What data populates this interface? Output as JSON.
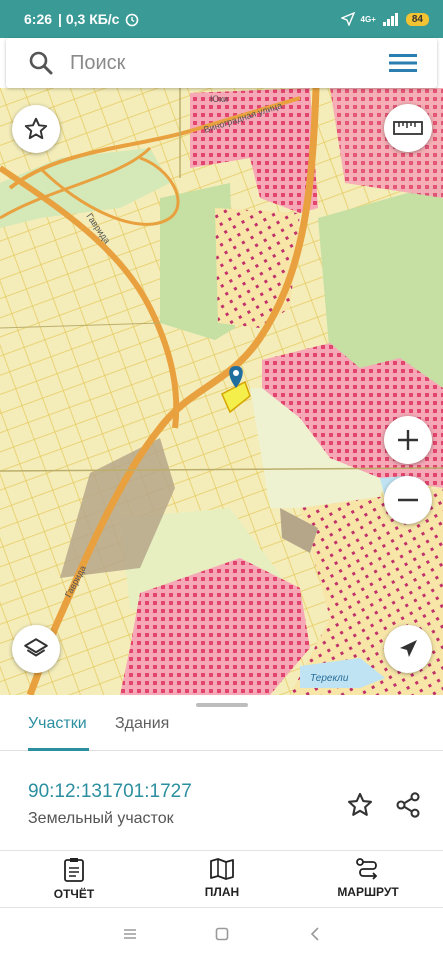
{
  "status_bar": {
    "time": "6:26",
    "speed": "| 0,3 КБ/с",
    "network": "4G+",
    "battery": "84"
  },
  "search": {
    "placeholder": "Поиск"
  },
  "map": {
    "labels": {
      "street_top": "Виноградная улица",
      "street_top_short": "Юки",
      "road_left": "Гаврида",
      "road_bottom": "Гаврида",
      "water": "Терекли"
    },
    "colors": {
      "base": "#f4edb9",
      "green": "#c6e0a4",
      "urban": "#f08ca0",
      "road": "#e8a13e",
      "parcel_line": "#e6c85a",
      "pin": "#1f6e9e"
    }
  },
  "sheet": {
    "tabs": [
      {
        "label": "Участки",
        "active": true
      },
      {
        "label": "Здания",
        "active": false
      }
    ],
    "parcel": {
      "cadastral_number": "90:12:131701:1727",
      "type": "Земельный участок"
    },
    "actions": [
      {
        "label": "ОТЧЁТ",
        "icon": "report-icon"
      },
      {
        "label": "ПЛАН",
        "icon": "map-plan-icon"
      },
      {
        "label": "МАРШРУТ",
        "icon": "route-icon"
      }
    ]
  }
}
